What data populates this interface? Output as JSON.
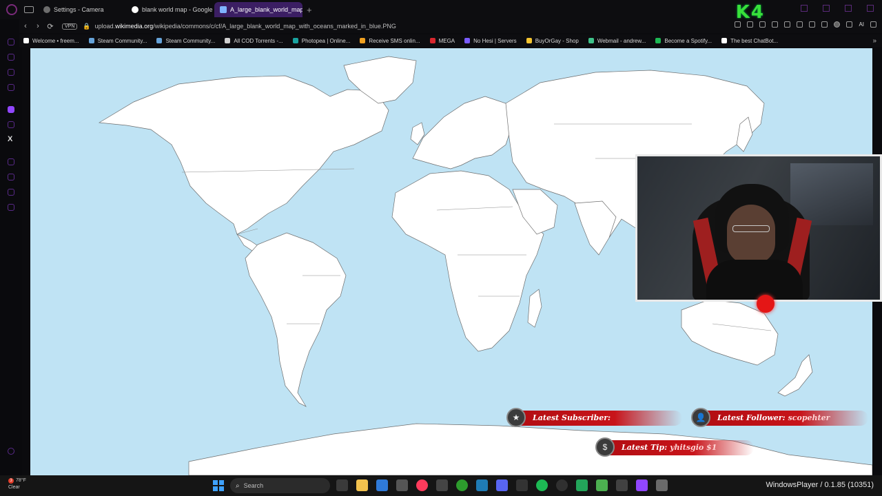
{
  "browser": {
    "tabs": [
      {
        "title": "Settings - Camera",
        "favicon": "gear-icon",
        "active": false
      },
      {
        "title": "blank world map - Google",
        "favicon": "google-icon",
        "active": false
      },
      {
        "title": "A_large_blank_world_map",
        "favicon": "wikimedia-icon",
        "active": true
      }
    ],
    "new_tab_label": "+",
    "address": {
      "vpn_label": "VPN",
      "url_domain_prefix": "upload.",
      "url_domain": "wikimedia.org",
      "url_path": "/wikipedia/commons/c/cf/A_large_blank_world_map_with_oceans_marked_in_blue.PNG"
    },
    "ai_label": "AI",
    "bookmarks": [
      {
        "label": "Welcome • freem...",
        "color": "#ffffff"
      },
      {
        "label": "Steam Community...",
        "color": "#66a3d9"
      },
      {
        "label": "Steam Community...",
        "color": "#66a3d9"
      },
      {
        "label": "All COD Torrents -...",
        "color": "#cfcfcf"
      },
      {
        "label": "Photopea | Online...",
        "color": "#19a3a0"
      },
      {
        "label": "Receive SMS onlin...",
        "color": "#f0a020"
      },
      {
        "label": "MEGA",
        "color": "#d9272e"
      },
      {
        "label": "No Hesi | Servers",
        "color": "#7a5cff"
      },
      {
        "label": "BuyOrGay - Shop",
        "color": "#f4c430"
      },
      {
        "label": "Webmail - andrew...",
        "color": "#3fc28a"
      },
      {
        "label": "Become a Spotify...",
        "color": "#1db954"
      },
      {
        "label": "The best ChatBot...",
        "color": "#ffffff"
      }
    ],
    "bookmarks_more": "»"
  },
  "overlay": {
    "logo_text": "K4",
    "latest_subscriber_label": "Latest Subscriber:",
    "latest_subscriber_value": "",
    "latest_follower_label": "Latest Follower:",
    "latest_follower_value": "scopehter",
    "latest_tip_label": "Latest Tip:",
    "latest_tip_value": "yhitsgio $1"
  },
  "taskbar": {
    "weather_badge": "3",
    "weather_temp": "78°F",
    "weather_desc": "Clear",
    "search_placeholder": "Search",
    "window_label": "WindowsPlayer / 0.1.85 (10351)"
  },
  "colors": {
    "ocean": "#bfe3f4",
    "active_tab": "#3b1e63",
    "accent_green": "#38e03a",
    "banner_red": "#c8141a"
  }
}
